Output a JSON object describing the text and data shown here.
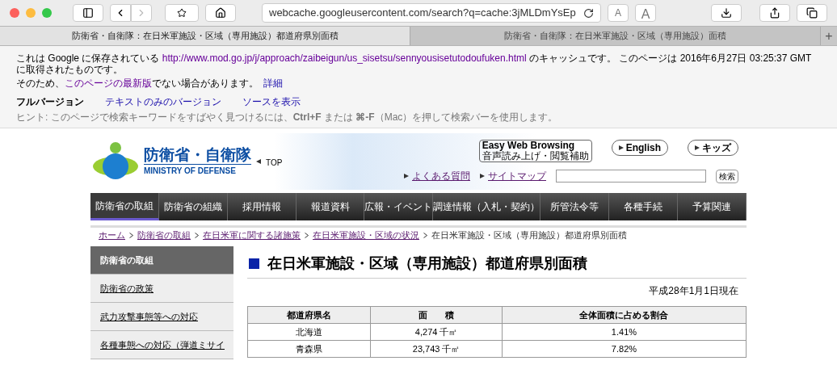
{
  "browser": {
    "url": "webcache.googleusercontent.com/search?q=cache:3jMLDmYsEp",
    "font_buttons": [
      "A",
      "A"
    ],
    "tabs": [
      {
        "label": "防衛省・自衛隊：在日米軍施設・区域（専用施設）都道府県別面積",
        "selected": true
      },
      {
        "label": "防衛省・自衛隊：在日米軍施設・区域（専用施設）面積",
        "selected": false
      }
    ],
    "new_tab": "+"
  },
  "cache_banner": {
    "line1_before": "これは Google に保存されている",
    "line1_link": "http://www.mod.go.jp/j/approach/zaibeigun/us_sisetsu/sennyousisetutodoufuken.html",
    "line1_after": "のキャッシュです。 このページは 2016年6月27日 03:25:37 GMT に取得されたものです。",
    "line2_before": "そのため、",
    "line2_link": "このページの最新版",
    "line2_after": "でない場合があります。",
    "details_link": "詳細",
    "versions": [
      {
        "label": "フルバージョン",
        "selected": true
      },
      {
        "label": "テキストのみのバージョン",
        "selected": false
      },
      {
        "label": "ソースを表示",
        "selected": false
      }
    ],
    "hint": "ヒント: このページで検索キーワードをすばやく見つけるには、**Ctrl+F** または **⌘-F**（Mac）を押して検索バーを使用します。"
  },
  "site_header": {
    "logo_title": "防衛省・自衛隊",
    "logo_subtitle": "MINISTRY OF DEFENSE",
    "top_link": "TOP",
    "easy_caption": "Easy Web Browsing",
    "easy_button": "音声読み上げ・閲覧補助",
    "lang_buttons": [
      "English",
      "キッズ"
    ],
    "links": [
      "よくある質問",
      "サイトマップ"
    ],
    "search_button": "検索"
  },
  "nav": [
    {
      "label": "防衛省の取組",
      "selected": true
    },
    {
      "label": "防衛省の組織",
      "selected": false
    },
    {
      "label": "採用情報",
      "selected": false
    },
    {
      "label": "報道資料",
      "selected": false
    },
    {
      "label": "広報・イベント",
      "selected": false
    },
    {
      "label": "調達情報（入札・契約）",
      "selected": false
    },
    {
      "label": "所管法令等",
      "selected": false
    },
    {
      "label": "各種手続",
      "selected": false
    },
    {
      "label": "予算関連",
      "selected": false
    }
  ],
  "breadcrumb": {
    "links": [
      "ホーム",
      "防衛省の取組",
      "在日米軍に関する諸施策",
      "在日米軍施設・区域の状況"
    ],
    "current": "在日米軍施設・区域（専用施設）都道府県別面積"
  },
  "sidebar": [
    {
      "label": "防衛省の取組",
      "selected": true
    },
    {
      "label": "防衛省の政策",
      "selected": false
    },
    {
      "label": "武力攻撃事態等への対応",
      "selected": false
    },
    {
      "label": "各種事態への対応（弾道ミサイ",
      "selected": false
    }
  ],
  "content": {
    "title": "在日米軍施設・区域（専用施設）都道府県別面積",
    "date": "平成28年1月1日現在",
    "table": {
      "columns": [
        "都道府県名",
        "面　　積",
        "全体面積に占める割合"
      ],
      "rows": [
        [
          "北海道",
          "4,274 千㎡",
          "1.41%"
        ],
        [
          "青森県",
          "23,743 千㎡",
          "7.82%"
        ]
      ]
    }
  }
}
